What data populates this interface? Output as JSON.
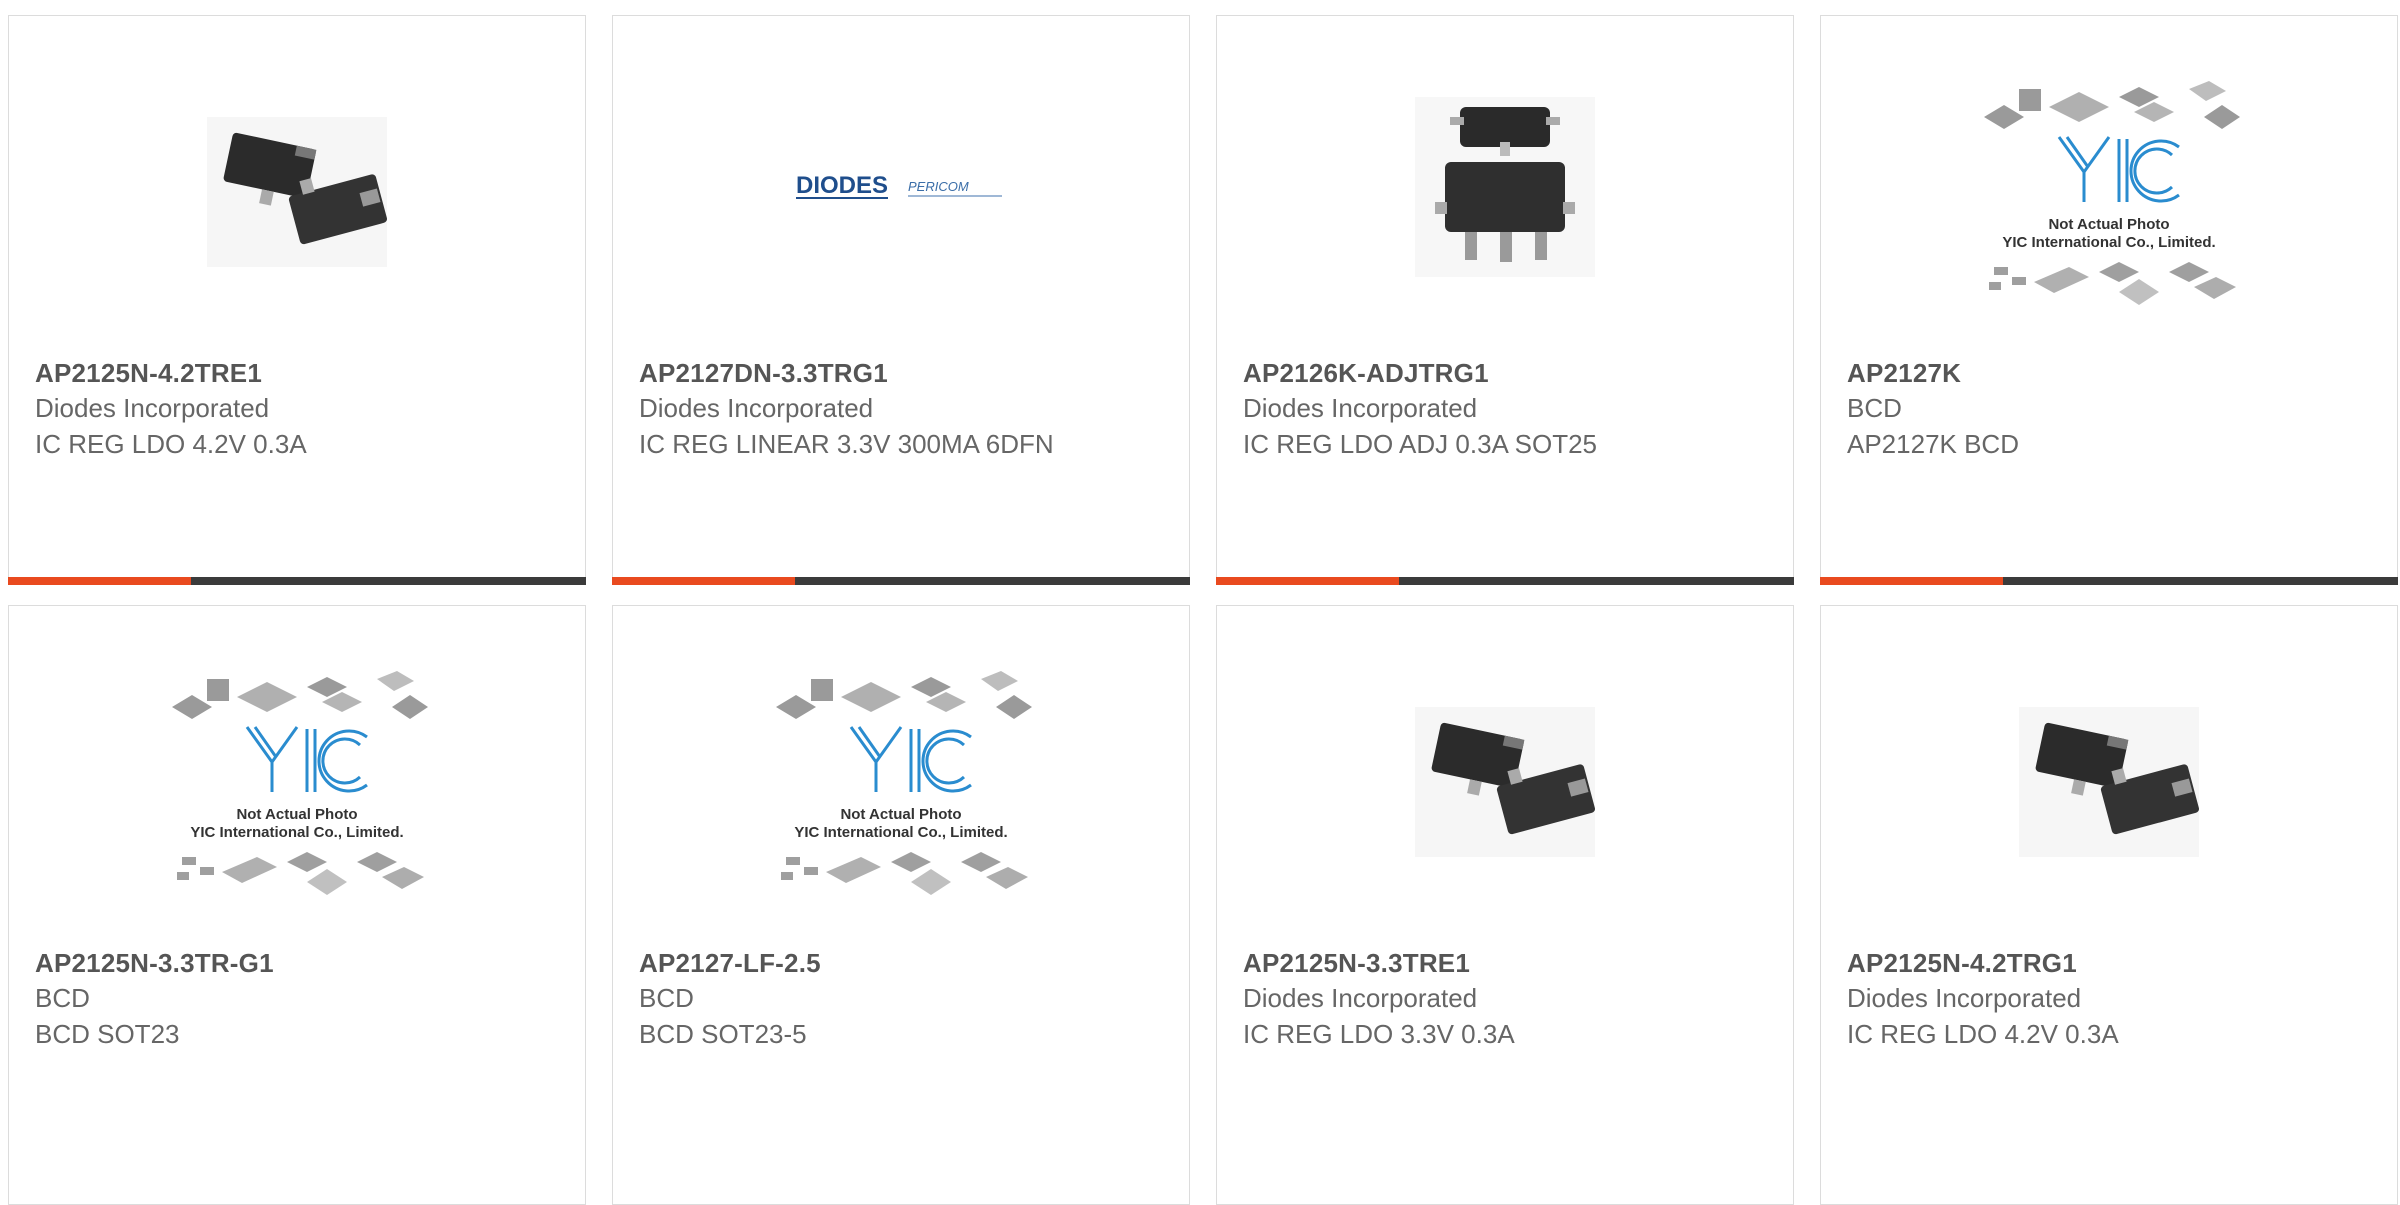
{
  "products": [
    {
      "part": "AP2125N-4.2TRE1",
      "manufacturer": "Diodes Incorporated",
      "description": "IC REG LDO 4.2V 0.3A",
      "image": "sot23-package-photo",
      "show_bar": true
    },
    {
      "part": "AP2127DN-3.3TRG1",
      "manufacturer": "Diodes Incorporated",
      "description": "IC REG LINEAR 3.3V 300MA 6DFN",
      "image": "diodes-pericom-logo",
      "show_bar": true
    },
    {
      "part": "AP2126K-ADJTRG1",
      "manufacturer": "Diodes Incorporated",
      "description": "IC REG LDO ADJ 0.3A SOT25",
      "image": "sot25-package-photo",
      "show_bar": true
    },
    {
      "part": "AP2127K",
      "manufacturer": "BCD",
      "description": "AP2127K BCD",
      "image": "yic-not-actual-photo",
      "show_bar": true
    },
    {
      "part": "AP2125N-3.3TR-G1",
      "manufacturer": "BCD",
      "description": "BCD SOT23",
      "image": "yic-not-actual-photo",
      "show_bar": false
    },
    {
      "part": "AP2127-LF-2.5",
      "manufacturer": "BCD",
      "description": "BCD SOT23-5",
      "image": "yic-not-actual-photo",
      "show_bar": false
    },
    {
      "part": "AP2125N-3.3TRE1",
      "manufacturer": "Diodes Incorporated",
      "description": "IC REG LDO 3.3V 0.3A",
      "image": "sot23-package-photo",
      "show_bar": false
    },
    {
      "part": "AP2125N-4.2TRG1",
      "manufacturer": "Diodes Incorporated",
      "description": "IC REG LDO 4.2V 0.3A",
      "image": "sot23-package-photo",
      "show_bar": false
    }
  ],
  "yic_placeholder": {
    "line1": "Not Actual Photo",
    "line2": "YIC International Co., Limited."
  },
  "logo": {
    "brand": "DIODES",
    "sub": "PERICOM"
  },
  "colors": {
    "accent": "#e94a1f",
    "bar_dark": "#3b3b3b",
    "yic_blue": "#2a8ccf"
  }
}
